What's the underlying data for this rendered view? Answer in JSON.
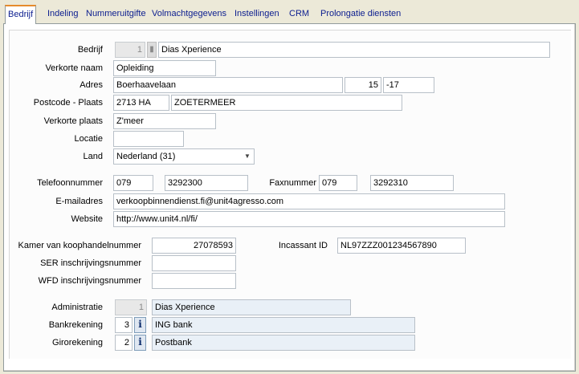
{
  "tabs": [
    {
      "label": "Bedrijf",
      "active": true
    },
    {
      "label": "Indeling"
    },
    {
      "label": "Nummeruitgifte"
    },
    {
      "label": "Volmachtgegevens"
    },
    {
      "label": "Instellingen"
    },
    {
      "label": "CRM"
    },
    {
      "label": "Prolongatie diensten"
    }
  ],
  "form": {
    "bedrijf": {
      "label": "Bedrijf",
      "nr": "1",
      "name": "Dias Xperience"
    },
    "verkorte_naam": {
      "label": "Verkorte naam",
      "value": "Opleiding"
    },
    "adres": {
      "label": "Adres",
      "street": "Boerhaavelaan",
      "number": "15",
      "suffix": "-17"
    },
    "postcode_plaats": {
      "label": "Postcode - Plaats",
      "postcode": "2713 HA",
      "plaats": "ZOETERMEER"
    },
    "verkorte_plaats": {
      "label": "Verkorte plaats",
      "value": "Z'meer"
    },
    "locatie": {
      "label": "Locatie",
      "value": ""
    },
    "land": {
      "label": "Land",
      "value": "Nederland (31)"
    },
    "telefoon": {
      "label": "Telefoonnummer",
      "area": "079",
      "number": "3292300"
    },
    "fax": {
      "label": "Faxnummer",
      "area": "079",
      "number": "3292310"
    },
    "email": {
      "label": "E-mailadres",
      "value": "verkoopbinnendienst.fi@unit4agresso.com"
    },
    "website": {
      "label": "Website",
      "value": "http://www.unit4.nl/fi/"
    },
    "kvk": {
      "label": "Kamer van koophandelnummer",
      "value": "27078593"
    },
    "incassant": {
      "label": "Incassant ID",
      "value": "NL97ZZZ001234567890"
    },
    "ser": {
      "label": "SER inschrijvingsnummer",
      "value": ""
    },
    "wfd": {
      "label": "WFD inschrijvingsnummer",
      "value": ""
    },
    "administratie": {
      "label": "Administratie",
      "nr": "1",
      "name": "Dias Xperience"
    },
    "bankrekening": {
      "label": "Bankrekening",
      "nr": "3",
      "name": "ING bank"
    },
    "girorekening": {
      "label": "Girorekening",
      "nr": "2",
      "name": "Postbank"
    }
  },
  "icons": {
    "info": "i",
    "dropdown": "▼"
  }
}
